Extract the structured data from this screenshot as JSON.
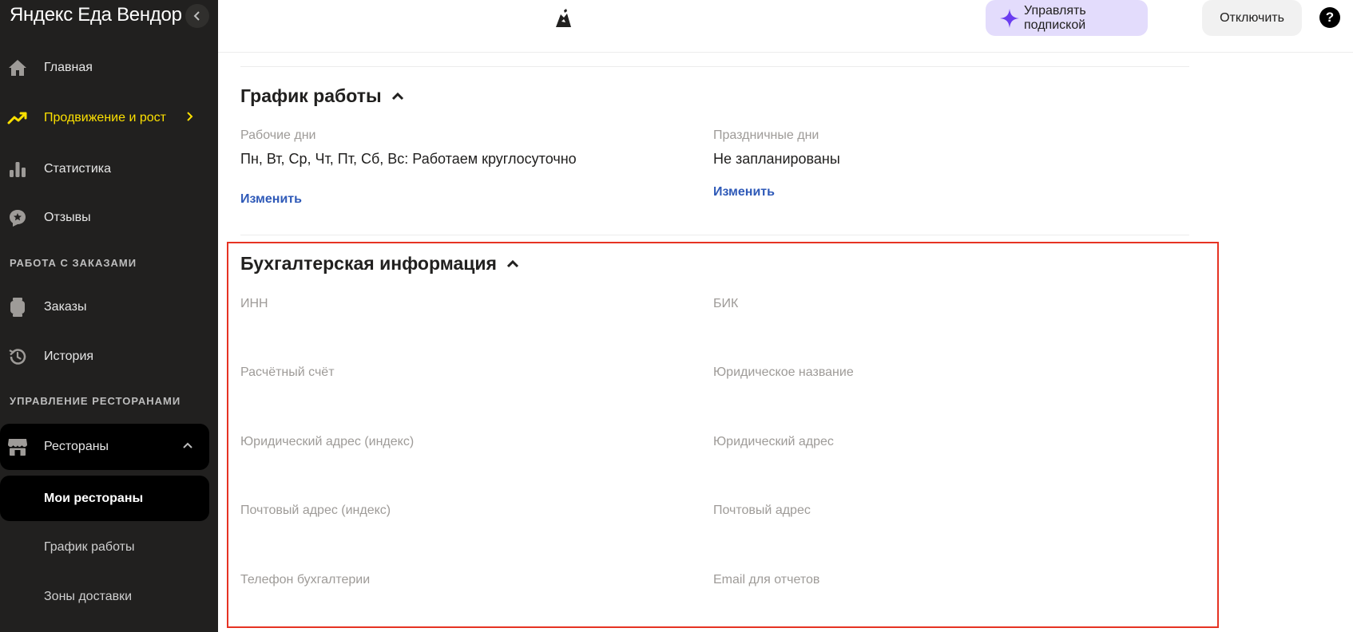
{
  "sidebar": {
    "brand": "Яндекс Еда Вендор",
    "items": [
      {
        "label": "Главная",
        "icon": "home-icon"
      },
      {
        "label": "Продвижение и рост",
        "icon": "trend-up-icon"
      },
      {
        "label": "Статистика",
        "icon": "bar-chart-icon"
      },
      {
        "label": "Отзывы",
        "icon": "review-star-icon"
      }
    ],
    "section_orders": "РАБОТА С ЗАКАЗАМИ",
    "order_items": [
      {
        "label": "Заказы",
        "icon": "watch-icon"
      },
      {
        "label": "История",
        "icon": "history-icon"
      }
    ],
    "section_restaurants": "УПРАВЛЕНИЕ РЕСТОРАНАМИ",
    "restaurants": {
      "label": "Рестораны",
      "icon": "store-icon"
    },
    "sub_items": [
      {
        "label": "Мои рестораны"
      },
      {
        "label": "График работы"
      },
      {
        "label": "Зоны доставки"
      }
    ]
  },
  "topbar": {
    "manage_subscription": "Управлять подпиской",
    "disable": "Отключить",
    "help": "?"
  },
  "schedule": {
    "title": "График работы",
    "work_days_label": "Рабочие дни",
    "work_days_value": "Пн, Вт, Ср, Чт, Пт, Сб, Вс: Работаем круглосуточно",
    "holidays_label": "Праздничные дни",
    "holidays_value": "Не запланированы",
    "edit_link": "Изменить"
  },
  "accounting": {
    "title": "Бухгалтерская информация",
    "fields_left": [
      "ИНН",
      "Расчётный счёт",
      "Юридический адрес (индекс)",
      "Почтовый адрес (индекс)",
      "Телефон бухгалтерии"
    ],
    "fields_right": [
      "БИК",
      "Юридическое название",
      "Юридический адрес",
      "Почтовый адрес",
      "Email для отчетов"
    ]
  },
  "colors": {
    "sidebar_bg": "#21201f",
    "active_nav": "#fce000",
    "link": "#2f5ab8",
    "highlight": "#e63323",
    "subscription_bg": "#e3dcfc"
  }
}
